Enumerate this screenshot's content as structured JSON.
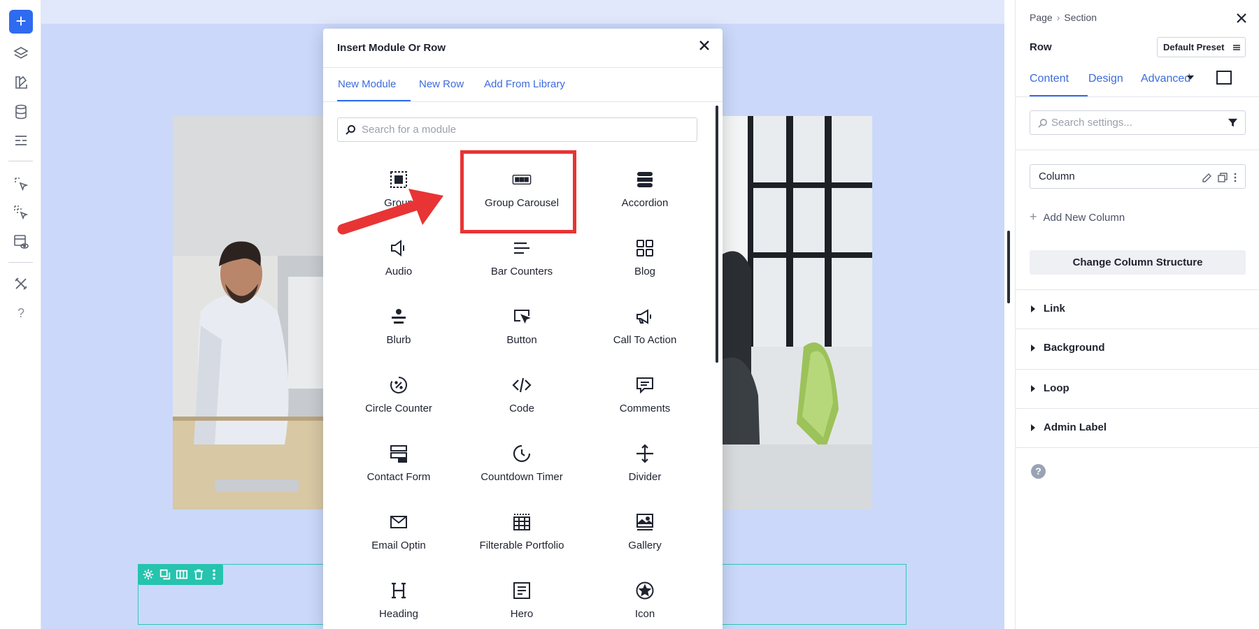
{
  "left_toolbar": {
    "add_label": "+",
    "icons": [
      "plus-icon",
      "layers-icon",
      "theme-icon",
      "database-icon",
      "layout-icon",
      "pointer-select-icon",
      "multi-select-icon",
      "preview-icon",
      "tools-icon",
      "help-icon"
    ],
    "help_label": "?"
  },
  "modal": {
    "title": "Insert Module Or Row",
    "tabs": [
      "New Module",
      "New Row",
      "Add From Library"
    ],
    "active_tab": "New Module",
    "search_placeholder": "Search for a module",
    "modules": [
      {
        "label": "Group",
        "icon": "group-icon"
      },
      {
        "label": "Group Carousel",
        "icon": "group-carousel-icon"
      },
      {
        "label": "Accordion",
        "icon": "accordion-icon"
      },
      {
        "label": "Audio",
        "icon": "audio-icon"
      },
      {
        "label": "Bar Counters",
        "icon": "bar-counters-icon"
      },
      {
        "label": "Blog",
        "icon": "blog-icon"
      },
      {
        "label": "Blurb",
        "icon": "blurb-icon"
      },
      {
        "label": "Button",
        "icon": "button-icon"
      },
      {
        "label": "Call To Action",
        "icon": "call-to-action-icon"
      },
      {
        "label": "Circle Counter",
        "icon": "circle-counter-icon"
      },
      {
        "label": "Code",
        "icon": "code-icon"
      },
      {
        "label": "Comments",
        "icon": "comments-icon"
      },
      {
        "label": "Contact Form",
        "icon": "contact-form-icon"
      },
      {
        "label": "Countdown Timer",
        "icon": "countdown-timer-icon"
      },
      {
        "label": "Divider",
        "icon": "divider-icon"
      },
      {
        "label": "Email Optin",
        "icon": "email-optin-icon"
      },
      {
        "label": "Filterable Portfolio",
        "icon": "filterable-portfolio-icon"
      },
      {
        "label": "Gallery",
        "icon": "gallery-icon"
      },
      {
        "label": "Heading",
        "icon": "heading-icon"
      },
      {
        "label": "Hero",
        "icon": "hero-icon"
      },
      {
        "label": "Icon",
        "icon": "icon-module-icon"
      }
    ],
    "highlighted_module": "Group Carousel",
    "highlight_color": "#e83434"
  },
  "right_panel": {
    "breadcrumb": [
      "Page",
      "Section"
    ],
    "title": "Row",
    "preset_label": "Default Preset",
    "tabs": [
      "Content",
      "Design",
      "Advanced"
    ],
    "active_tab": "Content",
    "search_placeholder": "Search settings...",
    "column_item": "Column",
    "add_column_label": "Add New Column",
    "change_structure_label": "Change Column Structure",
    "sections": [
      "Link",
      "Background",
      "Loop",
      "Admin Label"
    ],
    "help_label": "?"
  },
  "colors": {
    "accent": "#2f6bf0",
    "canvas_bg": "#cbd8fa",
    "row_toolbar": "#26c3ae"
  }
}
